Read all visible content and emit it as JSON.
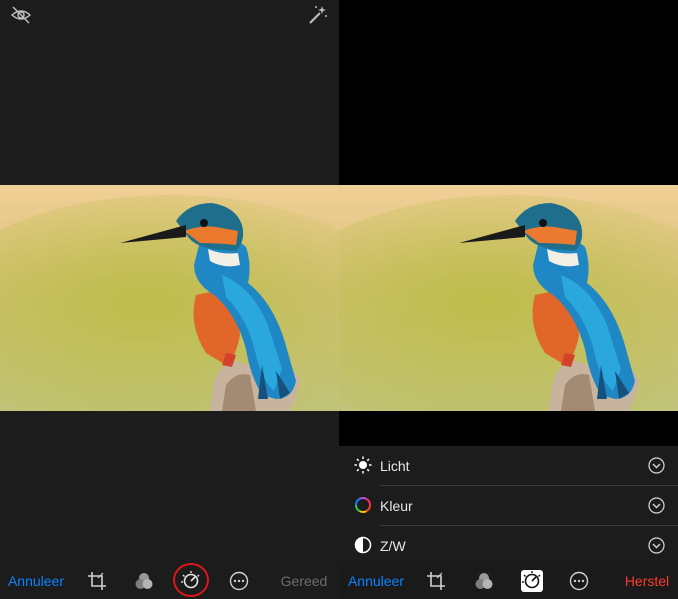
{
  "left_panel": {
    "toolbar": {
      "cancel_label": "Annuleer",
      "done_label": "Gereed"
    }
  },
  "right_panel": {
    "adjust_sections": [
      {
        "label": "Licht",
        "icon": "sun-icon"
      },
      {
        "label": "Kleur",
        "icon": "color-wheel-icon"
      },
      {
        "label": "Z/W",
        "icon": "half-circle-icon"
      }
    ],
    "toolbar": {
      "cancel_label": "Annuleer",
      "revert_label": "Herstel"
    }
  },
  "colors": {
    "accent_blue": "#0a84ff",
    "revert_red": "#ff3b30",
    "highlight_ring": "#e0151a",
    "disabled_grey": "#6d6d6d"
  }
}
